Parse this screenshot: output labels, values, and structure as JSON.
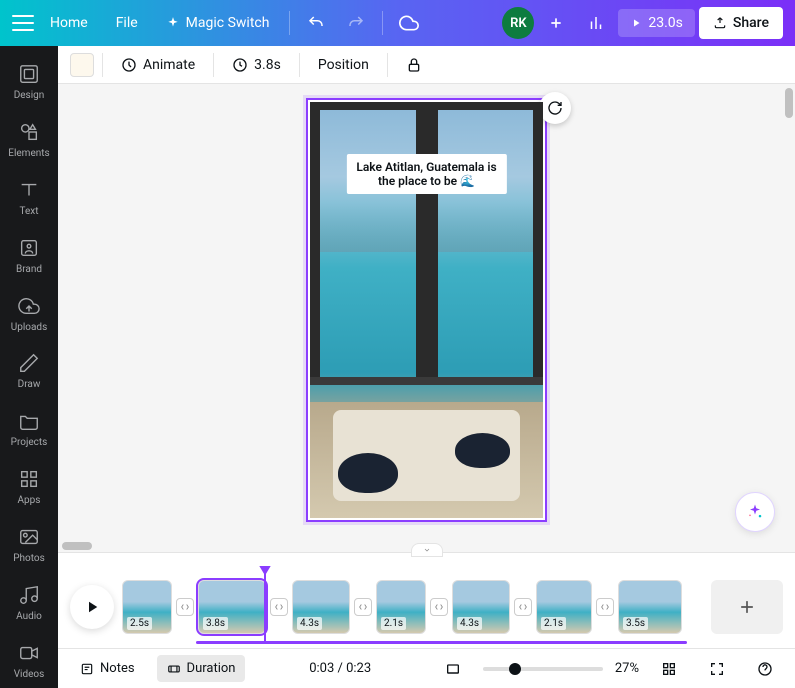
{
  "topbar": {
    "home": "Home",
    "file": "File",
    "magic_switch": "Magic Switch",
    "avatar_initials": "RK",
    "duration_badge": "23.0s",
    "share": "Share"
  },
  "toolbar": {
    "animate": "Animate",
    "duration": "3.8s",
    "position": "Position"
  },
  "sidebar": {
    "items": [
      {
        "label": "Design"
      },
      {
        "label": "Elements"
      },
      {
        "label": "Text"
      },
      {
        "label": "Brand"
      },
      {
        "label": "Uploads"
      },
      {
        "label": "Draw"
      },
      {
        "label": "Projects"
      },
      {
        "label": "Apps"
      },
      {
        "label": "Photos"
      },
      {
        "label": "Audio"
      },
      {
        "label": "Videos"
      }
    ]
  },
  "canvas": {
    "caption_line1": "Lake Atitlan, Guatemala is",
    "caption_line2": "the place to be 🌊"
  },
  "timeline": {
    "clips": [
      {
        "dur": "2.5s",
        "w": 50
      },
      {
        "dur": "3.8s",
        "w": 68,
        "selected": true
      },
      {
        "dur": "4.3s",
        "w": 58
      },
      {
        "dur": "2.1s",
        "w": 50
      },
      {
        "dur": "4.3s",
        "w": 58
      },
      {
        "dur": "2.1s",
        "w": 56
      },
      {
        "dur": "3.5s",
        "w": 64
      }
    ]
  },
  "footer": {
    "notes": "Notes",
    "duration": "Duration",
    "time": "0:03 / 0:23",
    "zoom": "27%"
  },
  "colors": {
    "accent": "#8b3dff"
  }
}
